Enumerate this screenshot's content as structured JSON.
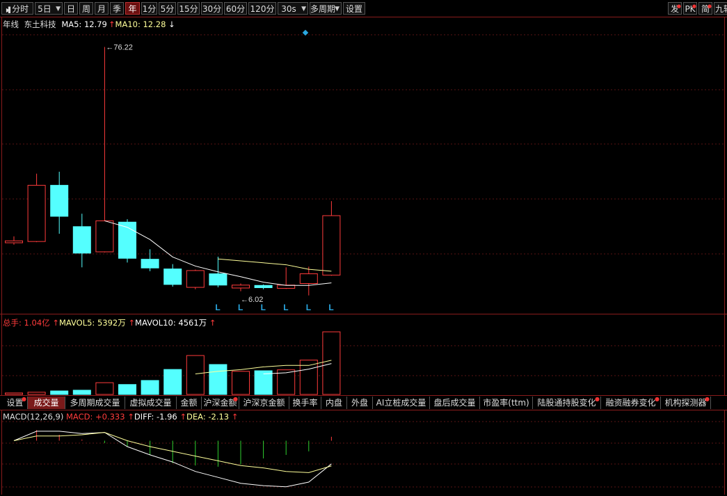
{
  "toolbar": {
    "items": [
      {
        "label": "分时",
        "icon": "play-icon"
      },
      {
        "label": "5日",
        "dropdown": true
      },
      {
        "label": "日"
      },
      {
        "label": "周"
      },
      {
        "label": "月"
      },
      {
        "label": "季"
      },
      {
        "label": "年",
        "active": true
      },
      {
        "label": "1分"
      },
      {
        "label": "5分"
      },
      {
        "label": "15分"
      },
      {
        "label": "30分"
      },
      {
        "label": "60分"
      },
      {
        "label": "120分"
      },
      {
        "label": "30s",
        "dropdown": true
      },
      {
        "label": "多周期",
        "dropdown": true
      },
      {
        "label": "设置"
      }
    ],
    "right_items": [
      {
        "label": "发"
      },
      {
        "label": "PK"
      },
      {
        "label": "简"
      },
      {
        "label": "九转"
      }
    ]
  },
  "price_panel": {
    "period_label": "年线",
    "stock_name": "东土科技",
    "ma5_label": "MA5: 12.79",
    "ma10_label": "MA10: 12.28",
    "ma5_arrow": "↑",
    "ma10_arrow": "↓",
    "high_label": "76.22",
    "low_label": "6.02",
    "marker_letter": "L"
  },
  "volume_panel": {
    "total_label": "总手: 1.04亿",
    "mavol5_label": "MAVOL5: 5392万",
    "mavol10_label": "MAVOL10: 4561万",
    "arrow": "↑"
  },
  "tabs": [
    {
      "label": "设置",
      "dot": true
    },
    {
      "label": "成交量",
      "active": true
    },
    {
      "label": "多周期成交量"
    },
    {
      "label": "虚拟成交量"
    },
    {
      "label": "金额"
    },
    {
      "label": "沪深金额",
      "dot": true
    },
    {
      "label": "沪深京金额"
    },
    {
      "label": "换手率"
    },
    {
      "label": "内盘"
    },
    {
      "label": "外盘"
    },
    {
      "label": "AI立桩成交量"
    },
    {
      "label": "盘后成交量"
    },
    {
      "label": "市盈率(ttm)"
    },
    {
      "label": "陆股通持股变化",
      "dot": true
    },
    {
      "label": "融资融券变化",
      "dot": true
    },
    {
      "label": "机构探测器",
      "dot": true
    }
  ],
  "macd_panel": {
    "name_label": "MACD(12,26,9)",
    "macd_label": "MACD: +0.333",
    "diff_label": "DIFF: -1.96",
    "dea_label": "DEA: -2.13",
    "arrow": "↑"
  },
  "colors": {
    "up": "#ff3b3b",
    "down": "#54ffff",
    "ma5": "#ffffff",
    "ma10": "#ffff9a",
    "grid": "#8a1c1c",
    "marker": "#2aa7e0"
  },
  "chart_data": {
    "type": "candlestick",
    "candles": [
      {
        "o": 15.6,
        "h": 17.6,
        "l": 15.0,
        "c": 16.2
      },
      {
        "o": 16.0,
        "h": 37.0,
        "l": 15.8,
        "c": 33.4
      },
      {
        "o": 33.4,
        "h": 37.6,
        "l": 18.4,
        "c": 23.8
      },
      {
        "o": 20.6,
        "h": 24.6,
        "l": 8.0,
        "c": 12.4
      },
      {
        "o": 12.8,
        "h": 76.22,
        "l": 12.6,
        "c": 22.4
      },
      {
        "o": 22.0,
        "h": 22.9,
        "l": 9.5,
        "c": 10.8
      },
      {
        "o": 10.5,
        "h": 13.6,
        "l": 6.8,
        "c": 7.8
      },
      {
        "o": 7.5,
        "h": 9.0,
        "l": 2.0,
        "c": 2.7
      },
      {
        "o": 1.8,
        "h": 7.3,
        "l": 1.2,
        "c": 7.0
      },
      {
        "o": 6.0,
        "h": 11.3,
        "l": 1.8,
        "c": 2.5
      },
      {
        "o": 1.6,
        "h": 3.0,
        "l": 0.6,
        "c": 2.5
      },
      {
        "o": 2.4,
        "h": 2.7,
        "l": 1.2,
        "c": 1.7
      },
      {
        "o": 1.5,
        "h": 8.0,
        "l": 1.3,
        "c": 2.5
      },
      {
        "o": 3.0,
        "h": 8.2,
        "l": -0.7,
        "c": 6.0
      },
      {
        "o": 5.6,
        "h": 28.5,
        "l": 5.4,
        "c": 24.0
      }
    ],
    "ma5": [
      null,
      null,
      null,
      null,
      22.4,
      20.4,
      16.6,
      11.2,
      8.4,
      6.6,
      5.1,
      3.4,
      2.4,
      2.4,
      3.2
    ],
    "ma10": [
      null,
      null,
      null,
      null,
      null,
      null,
      null,
      null,
      null,
      10.6,
      10.0,
      9.4,
      8.8,
      7.4,
      6.8
    ],
    "volume": [
      0.8,
      1.2,
      1.9,
      2.3,
      6.4,
      5.4,
      7.6,
      13.6,
      21.2,
      16.3,
      12.6,
      12.9,
      13.4,
      18.7,
      34.1
    ],
    "mavol5": [
      null,
      null,
      null,
      null,
      null,
      null,
      null,
      null,
      11.2,
      12.6,
      13.5,
      15.0,
      15.8,
      15.8,
      18.6
    ],
    "mavol10": [
      null,
      null,
      null,
      null,
      null,
      null,
      null,
      null,
      null,
      null,
      null,
      11.2,
      11.8,
      13.8,
      16.8
    ],
    "macd_hist": [
      0.0,
      0.9,
      0.5,
      0.1,
      -0.2,
      -0.5,
      -1.2,
      -1.9,
      -2.1,
      -2.2,
      -2.0,
      -1.5,
      -1.2,
      -0.9,
      0.333
    ],
    "diff": [
      0.0,
      0.8,
      0.8,
      0.6,
      0.7,
      -0.5,
      -1.2,
      -1.8,
      -2.6,
      -3.1,
      -3.6,
      -3.8,
      -3.9,
      -3.5,
      -1.96
    ],
    "dea": [
      0.0,
      0.4,
      0.4,
      0.5,
      0.7,
      0.0,
      -0.5,
      -0.9,
      -1.3,
      -1.7,
      -2.1,
      -2.3,
      -2.6,
      -2.7,
      -2.13
    ],
    "low_markers": [
      9,
      10,
      11,
      12,
      13,
      14
    ],
    "ylim_price": [
      -4,
      80
    ],
    "ylim_volume": [
      0,
      36
    ],
    "ylim_macd": [
      -4.5,
      1.5
    ]
  }
}
